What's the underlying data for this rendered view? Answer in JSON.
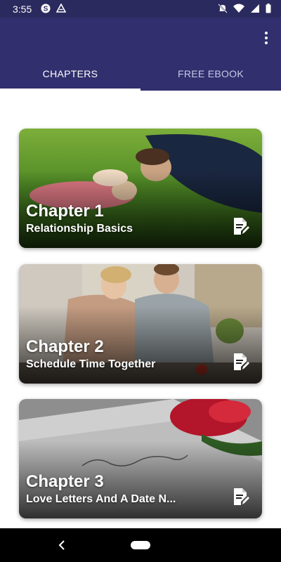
{
  "status_bar": {
    "time": "3:55",
    "left_icons": [
      "skype-icon",
      "drive-icon"
    ],
    "right_icons": [
      "mute-icon",
      "wifi-icon",
      "signal-icon",
      "battery-icon"
    ]
  },
  "app_bar": {
    "tabs": [
      {
        "label": "CHAPTERS",
        "active": true
      },
      {
        "label": "FREE EBOOK",
        "active": false
      }
    ],
    "accent_color": "#312f6d"
  },
  "chapters": [
    {
      "title": "Chapter 1",
      "subtitle": "Relationship Basics"
    },
    {
      "title": "Chapter 2",
      "subtitle": "Schedule Time Together"
    },
    {
      "title": "Chapter 3",
      "subtitle": "Love Letters And A Date N..."
    }
  ],
  "nav": {
    "back": "back-icon",
    "home": "home-pill"
  }
}
